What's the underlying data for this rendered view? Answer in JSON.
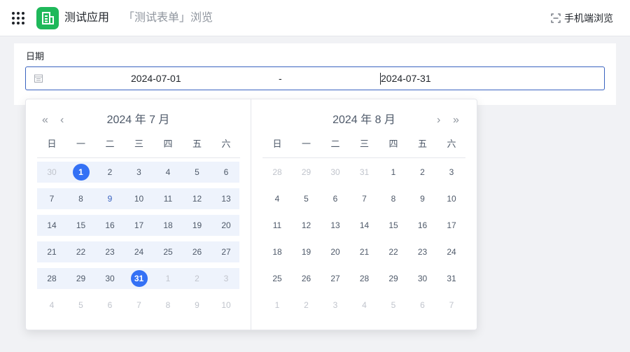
{
  "header": {
    "app_name": "测试应用",
    "page_title": "「测试表单」浏览",
    "mobile_view_label": "手机端浏览",
    "app_logo_color": "#1fb85a"
  },
  "form": {
    "field_label": "日期",
    "start_value": "2024-07-01",
    "separator": "-",
    "end_value": "2024-07-31",
    "accent_color": "#3471f5"
  },
  "calendar": {
    "weekdays": [
      "日",
      "一",
      "二",
      "三",
      "四",
      "五",
      "六"
    ],
    "left": {
      "title": "2024 年 7 月",
      "weeks": [
        [
          {
            "d": "30",
            "muted": true
          },
          {
            "d": "1",
            "selected": true
          },
          {
            "d": "2"
          },
          {
            "d": "3"
          },
          {
            "d": "4"
          },
          {
            "d": "5"
          },
          {
            "d": "6"
          }
        ],
        [
          {
            "d": "7"
          },
          {
            "d": "8"
          },
          {
            "d": "9",
            "today": true
          },
          {
            "d": "10"
          },
          {
            "d": "11"
          },
          {
            "d": "12"
          },
          {
            "d": "13"
          }
        ],
        [
          {
            "d": "14"
          },
          {
            "d": "15"
          },
          {
            "d": "16"
          },
          {
            "d": "17"
          },
          {
            "d": "18"
          },
          {
            "d": "19"
          },
          {
            "d": "20"
          }
        ],
        [
          {
            "d": "21"
          },
          {
            "d": "22"
          },
          {
            "d": "23"
          },
          {
            "d": "24"
          },
          {
            "d": "25"
          },
          {
            "d": "26"
          },
          {
            "d": "27"
          }
        ],
        [
          {
            "d": "28"
          },
          {
            "d": "29"
          },
          {
            "d": "30"
          },
          {
            "d": "31",
            "selected": true
          },
          {
            "d": "1",
            "muted": true
          },
          {
            "d": "2",
            "muted": true
          },
          {
            "d": "3",
            "muted": true
          }
        ],
        [
          {
            "d": "4",
            "muted": true
          },
          {
            "d": "5",
            "muted": true
          },
          {
            "d": "6",
            "muted": true
          },
          {
            "d": "7",
            "muted": true
          },
          {
            "d": "8",
            "muted": true
          },
          {
            "d": "9",
            "muted": true
          },
          {
            "d": "10",
            "muted": true
          }
        ]
      ],
      "range_rows": [
        {
          "from": 1,
          "to": 6
        },
        {
          "from": 0,
          "to": 6
        },
        {
          "from": 0,
          "to": 6
        },
        {
          "from": 0,
          "to": 6
        },
        {
          "from": 0,
          "to": 3
        }
      ]
    },
    "right": {
      "title": "2024 年 8 月",
      "weeks": [
        [
          {
            "d": "28",
            "muted": true
          },
          {
            "d": "29",
            "muted": true
          },
          {
            "d": "30",
            "muted": true
          },
          {
            "d": "31",
            "muted": true
          },
          {
            "d": "1"
          },
          {
            "d": "2"
          },
          {
            "d": "3"
          }
        ],
        [
          {
            "d": "4"
          },
          {
            "d": "5"
          },
          {
            "d": "6"
          },
          {
            "d": "7"
          },
          {
            "d": "8"
          },
          {
            "d": "9"
          },
          {
            "d": "10"
          }
        ],
        [
          {
            "d": "11"
          },
          {
            "d": "12"
          },
          {
            "d": "13"
          },
          {
            "d": "14"
          },
          {
            "d": "15"
          },
          {
            "d": "16"
          },
          {
            "d": "17"
          }
        ],
        [
          {
            "d": "18"
          },
          {
            "d": "19"
          },
          {
            "d": "20"
          },
          {
            "d": "21"
          },
          {
            "d": "22"
          },
          {
            "d": "23"
          },
          {
            "d": "24"
          }
        ],
        [
          {
            "d": "25"
          },
          {
            "d": "26"
          },
          {
            "d": "27"
          },
          {
            "d": "28"
          },
          {
            "d": "29"
          },
          {
            "d": "30"
          },
          {
            "d": "31"
          }
        ],
        [
          {
            "d": "1",
            "muted": true
          },
          {
            "d": "2",
            "muted": true
          },
          {
            "d": "3",
            "muted": true
          },
          {
            "d": "4",
            "muted": true
          },
          {
            "d": "5",
            "muted": true
          },
          {
            "d": "6",
            "muted": true
          },
          {
            "d": "7",
            "muted": true
          }
        ]
      ],
      "range_rows": []
    },
    "nav_icons": [
      "double-chevron-left-icon",
      "chevron-left-icon",
      "chevron-right-icon",
      "double-chevron-right-icon"
    ]
  }
}
